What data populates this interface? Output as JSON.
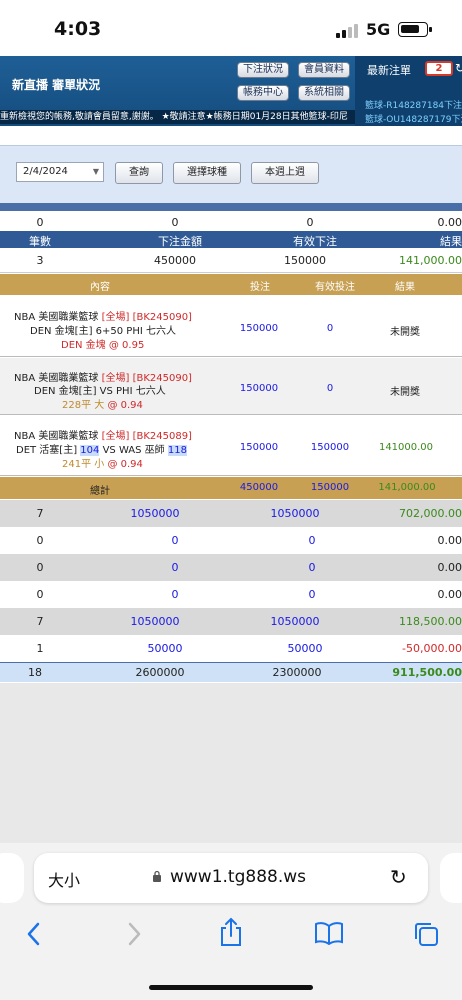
{
  "status_bar": {
    "time": "4:03",
    "network": "5G"
  },
  "header": {
    "nav": "新直播  審單狀況",
    "buttons": {
      "bet_status": "下注狀況",
      "member_info": "會員資料",
      "account_center": "帳務中心",
      "system": "系統相關"
    },
    "latest": {
      "title": "最新注單",
      "count": "2",
      "refresh": "↻",
      "rows": [
        "籃球-R148287184下注",
        "籃球-OU148287179下注"
      ]
    },
    "marquee": "重新檢視您的帳務,敬請會員留意,謝謝。  ★敬請注意★帳務日期01月28日其他籃球-印尼"
  },
  "query": {
    "date": "2/4/2024",
    "search": "查詢",
    "select_game": "選擇球種",
    "this_last_week": "本週上週"
  },
  "colors": {
    "header_blue": "#1e5f96",
    "gold": "#c7a053",
    "summary_blue": "#4a6ea7",
    "highlight": "#c8dcf8"
  },
  "top_row": {
    "count": "0",
    "bet": "0",
    "valid": "0",
    "result": "0.00"
  },
  "summary_header": {
    "count": "筆數",
    "bet": "下注金額",
    "valid": "有效下注",
    "result": "結果"
  },
  "summary_row": {
    "count": "3",
    "bet": "450000",
    "valid": "150000",
    "result": "141,000.00"
  },
  "bet_header": {
    "content": "內容",
    "stake": "投注",
    "valid": "有效投注",
    "result": "結果"
  },
  "bets": [
    {
      "league": "NBA 美國職業籃球",
      "tag": "[全場]",
      "code": "[BK245090]",
      "teams": "DEN 金塊[主] 6+50 PHI 七六人",
      "pick": "DEN 金塊",
      "odds": "@ 0.95",
      "stake": "150000",
      "valid": "0",
      "result": "未開獎"
    },
    {
      "league": "NBA 美國職業籃球",
      "tag": "[全場]",
      "code": "[BK245090]",
      "teams": "DEN 金塊[主] VS PHI 七六人",
      "pick": "228平 大",
      "odds": "@ 0.94",
      "stake": "150000",
      "valid": "0",
      "result": "未開獎"
    },
    {
      "league": "NBA 美國職業籃球",
      "tag": "[全場]",
      "code": "[BK245089]",
      "team_a": "DET 活塞[主]",
      "score_a": "104",
      "vs": "VS",
      "team_b": "WAS 巫師",
      "score_b": "118",
      "pick": "241平 小",
      "odds": "@ 0.94",
      "stake": "150000",
      "valid": "150000",
      "result": "141000.00"
    }
  ],
  "total_row": {
    "label": "總計",
    "stake": "450000",
    "valid": "150000",
    "result": "141,000.00"
  },
  "weekly_rows": [
    {
      "count": "7",
      "bet": "1050000",
      "valid": "1050000",
      "result": "702,000.00",
      "shade": "gray"
    },
    {
      "count": "0",
      "bet": "0",
      "valid": "0",
      "result": "0.00",
      "shade": "white"
    },
    {
      "count": "0",
      "bet": "0",
      "valid": "0",
      "result": "0.00",
      "shade": "gray"
    },
    {
      "count": "0",
      "bet": "0",
      "valid": "0",
      "result": "0.00",
      "shade": "white"
    },
    {
      "count": "7",
      "bet": "1050000",
      "valid": "1050000",
      "result": "118,500.00",
      "shade": "gray"
    },
    {
      "count": "1",
      "bet": "50000",
      "valid": "50000",
      "result": "-50,000.00",
      "shade": "white"
    }
  ],
  "grand_total": {
    "count": "18",
    "bet": "2600000",
    "valid": "2300000",
    "result": "911,500.00"
  },
  "browser": {
    "text_size": "大小",
    "url": "www1.tg888.ws"
  }
}
